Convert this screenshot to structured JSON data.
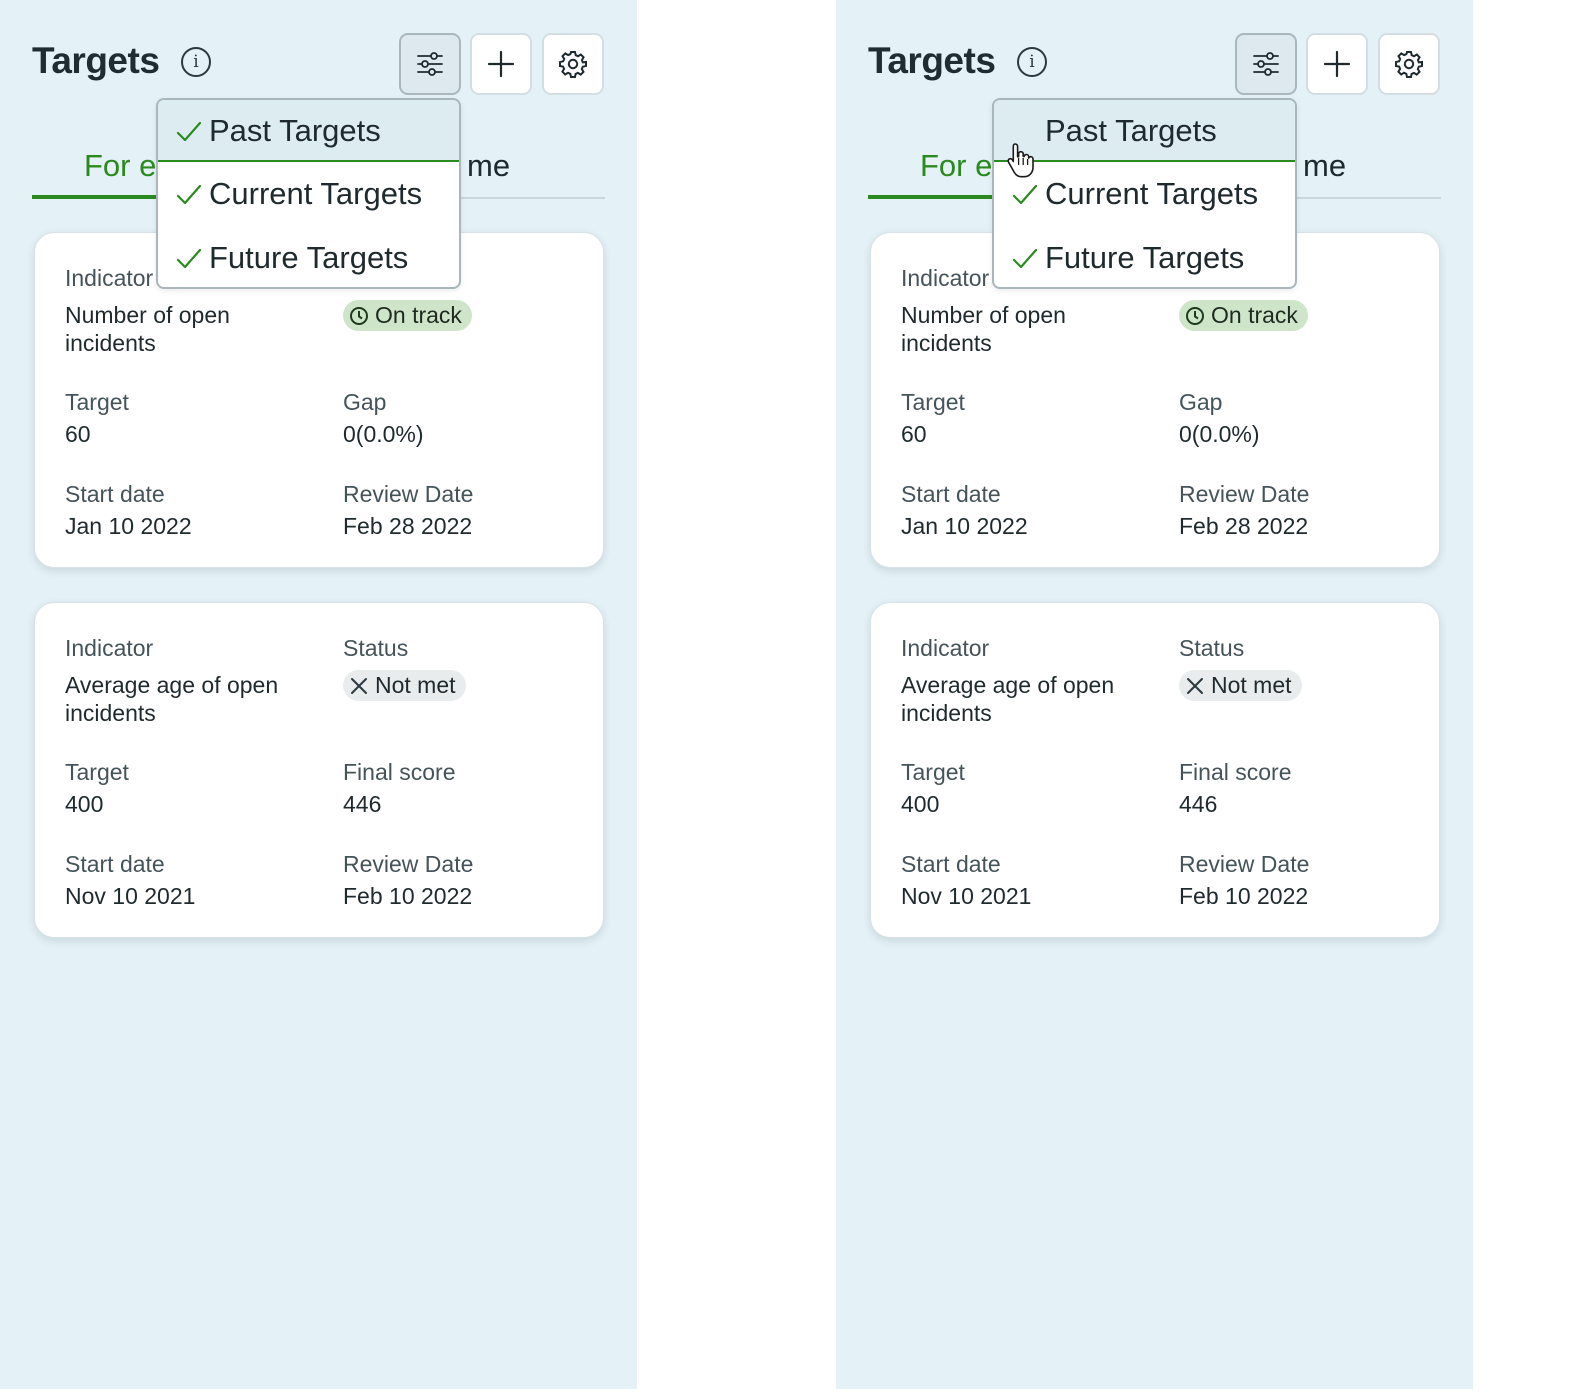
{
  "panels": [
    {
      "title": "Targets",
      "info_icon": "info-icon",
      "toolbar": {
        "filter_icon": "sliders-icon",
        "add_icon": "plus-icon",
        "settings_icon": "gear-icon"
      },
      "tabs": {
        "active_label": "For e",
        "other_label": "me"
      },
      "menu": {
        "items": [
          {
            "label": "Past Targets",
            "checked": true,
            "highlighted": true
          },
          {
            "label": "Current Targets",
            "checked": true,
            "highlighted": false
          },
          {
            "label": "Future Targets",
            "checked": true,
            "highlighted": false
          }
        ]
      },
      "cards": [
        {
          "indicator_label": "Indicator",
          "indicator_value": "Number of open incidents",
          "status_label": "",
          "status_value": "On track",
          "status_icon": "clock-icon",
          "target_label": "Target",
          "target_value": "60",
          "metric_label": "Gap",
          "metric_value": "0(0.0%)",
          "start_label": "Start date",
          "start_value": "Jan 10 2022",
          "review_label": "Review Date",
          "review_value": "Feb 28 2022"
        },
        {
          "indicator_label": "Indicator",
          "indicator_value": "Average age of open incidents",
          "status_label": "Status",
          "status_value": "Not met",
          "status_icon": "x-icon",
          "target_label": "Target",
          "target_value": "400",
          "metric_label": "Final score",
          "metric_value": "446",
          "start_label": "Start date",
          "start_value": "Nov 10 2021",
          "review_label": "Review Date",
          "review_value": "Feb 10 2022"
        }
      ]
    },
    {
      "title": "Targets",
      "info_icon": "info-icon",
      "toolbar": {
        "filter_icon": "sliders-icon",
        "add_icon": "plus-icon",
        "settings_icon": "gear-icon"
      },
      "tabs": {
        "active_label": "For e",
        "other_label": "me"
      },
      "menu": {
        "items": [
          {
            "label": "Past Targets",
            "checked": false,
            "highlighted": true
          },
          {
            "label": "Current Targets",
            "checked": true,
            "highlighted": false
          },
          {
            "label": "Future Targets",
            "checked": true,
            "highlighted": false
          }
        ]
      },
      "cards": [
        {
          "indicator_label": "Indicator",
          "indicator_value": "Number of open incidents",
          "status_label": "",
          "status_value": "On track",
          "status_icon": "clock-icon",
          "target_label": "Target",
          "target_value": "60",
          "metric_label": "Gap",
          "metric_value": "0(0.0%)",
          "start_label": "Start date",
          "start_value": "Jan 10 2022",
          "review_label": "Review Date",
          "review_value": "Feb 28 2022"
        },
        {
          "indicator_label": "Indicator",
          "indicator_value": "Average age of open incidents",
          "status_label": "Status",
          "status_value": "Not met",
          "status_icon": "x-icon",
          "target_label": "Target",
          "target_value": "400",
          "metric_label": "Final score",
          "metric_value": "446",
          "start_label": "Start date",
          "start_value": "Nov 10 2021",
          "review_label": "Review Date",
          "review_value": "Feb 10 2022"
        }
      ]
    }
  ],
  "colors": {
    "accent": "#2a8a1f",
    "panel_bg": "#e4f1f6",
    "on_track_bg": "#cfe5c9",
    "not_met_bg": "#e8eced"
  },
  "cursor_icon": "hand-pointer-icon"
}
